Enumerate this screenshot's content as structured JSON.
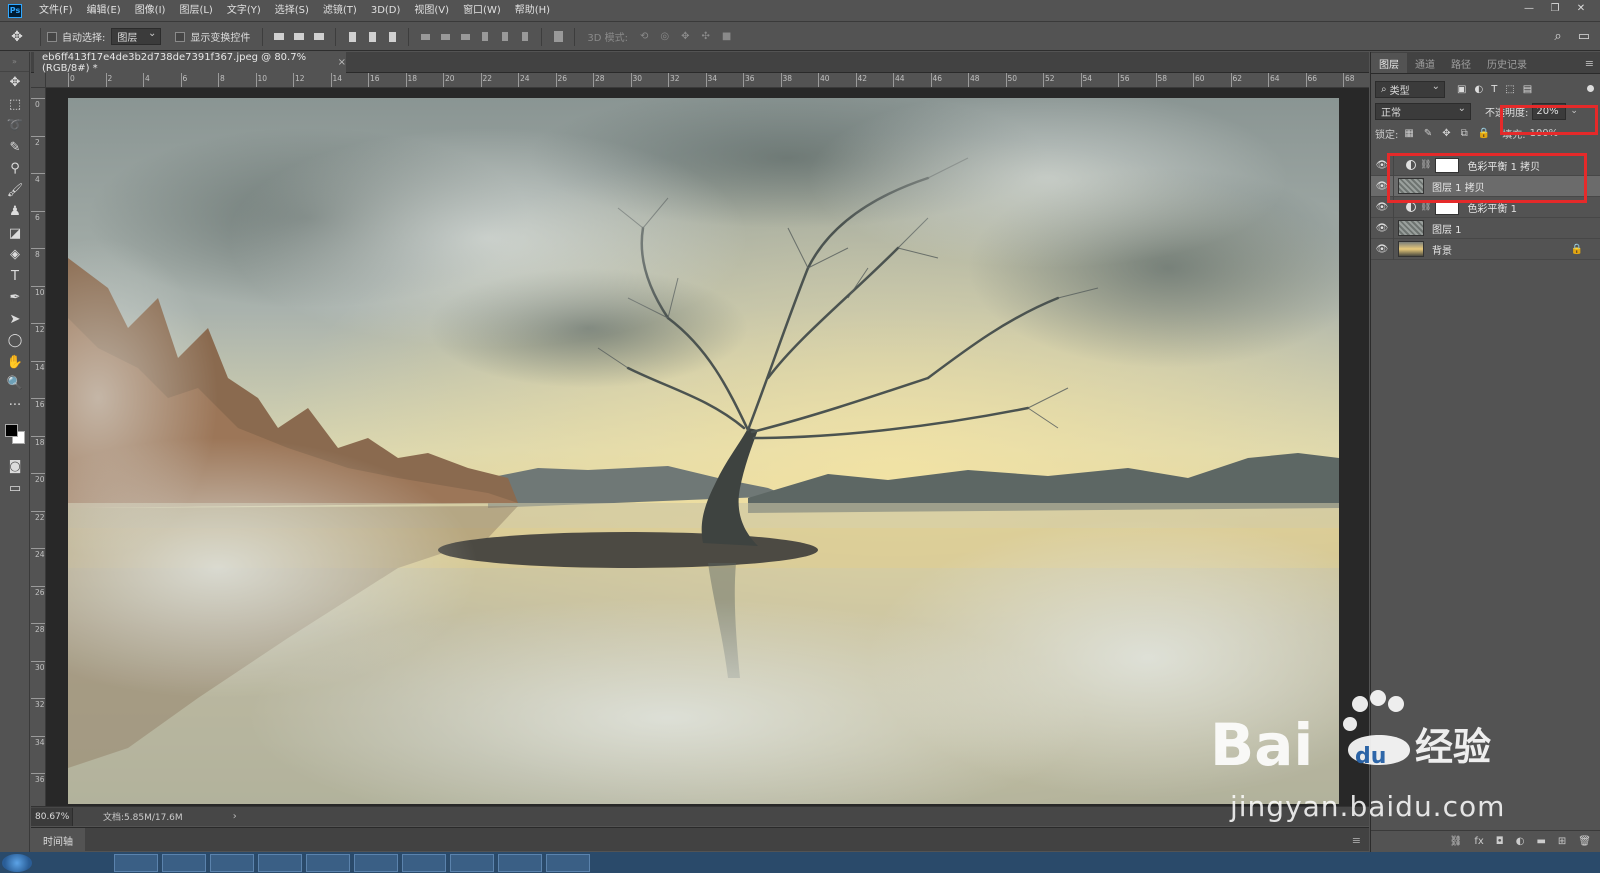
{
  "app": {
    "logo": "Ps",
    "window_controls": [
      "—",
      "❐",
      "✕"
    ]
  },
  "menu": [
    "文件(F)",
    "编辑(E)",
    "图像(I)",
    "图层(L)",
    "文字(Y)",
    "选择(S)",
    "滤镜(T)",
    "3D(D)",
    "视图(V)",
    "窗口(W)",
    "帮助(H)"
  ],
  "options": {
    "auto_select_label": "自动选择:",
    "auto_select_value": "图层",
    "show_transform_label": "显示变换控件",
    "mode_3d_label": "3D 模式:"
  },
  "document": {
    "tab_title": "eb6ff413f17e4de3b2d738de7391f367.jpeg @ 80.7%(RGB/8#) *",
    "zoom": "80.67%",
    "doc_info": "文档:5.85M/17.6M"
  },
  "ruler": {
    "h_labels": [
      "0",
      "2",
      "4",
      "6",
      "8",
      "10",
      "12",
      "14",
      "16",
      "18",
      "20",
      "22",
      "24",
      "26",
      "28",
      "30",
      "32",
      "34",
      "36",
      "38",
      "40",
      "42",
      "44",
      "46",
      "48",
      "50",
      "52",
      "54",
      "56",
      "58",
      "60",
      "62",
      "64",
      "66",
      "68"
    ],
    "v_labels": [
      "0",
      "2",
      "4",
      "6",
      "8",
      "10",
      "12",
      "14",
      "16",
      "18",
      "20",
      "22",
      "24",
      "26",
      "28",
      "30",
      "32",
      "34",
      "36"
    ]
  },
  "timeline": {
    "tab_label": "时间轴"
  },
  "panel": {
    "tabs": [
      "图层",
      "通道",
      "路径",
      "历史记录"
    ],
    "filter_value": "类型",
    "blend_mode": "正常",
    "opacity_label": "不透明度:",
    "opacity_value": "20%",
    "lock_label": "锁定:",
    "fill_label": "填充:",
    "fill_value": "100%",
    "layers": [
      {
        "name": "色彩平衡 1 拷贝",
        "kind": "adjustment",
        "selected": false
      },
      {
        "name": "图层 1 拷贝",
        "kind": "cloud",
        "selected": true
      },
      {
        "name": "色彩平衡 1",
        "kind": "adjustment",
        "selected": false
      },
      {
        "name": "图层 1",
        "kind": "cloud",
        "selected": false
      },
      {
        "name": "背景",
        "kind": "background",
        "selected": false
      }
    ],
    "footer_icons": [
      "link-icon",
      "fx-icon",
      "mask-icon",
      "adjustment-icon",
      "folder-icon",
      "new-layer-icon",
      "trash-icon"
    ]
  },
  "watermark": {
    "brand": "Bai du 经验",
    "url": "jingyan.baidu.com"
  },
  "colors": {
    "highlight": "#e52a2a",
    "ui_bg": "#535353"
  }
}
